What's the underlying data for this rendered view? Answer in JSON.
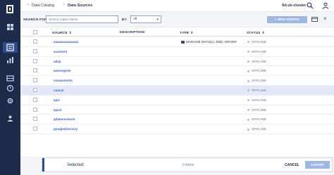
{
  "breadcrumb": {
    "items": [
      "Data Catalog",
      "Data Sources"
    ],
    "cluster": "fid-zk-cluster"
  },
  "filters": {
    "search_for_label": "SEARCH FOR",
    "search_placeholder": "Source | Spec Name",
    "by_label": "BY",
    "by_value": "All",
    "new_source_label": "+  NEW SOURCE"
  },
  "table": {
    "columns": {
      "source": "SOURCE",
      "description": "DESCRIPTION",
      "type": "TYPE",
      "status": "STATUS"
    },
    "rows": [
      {
        "source": "aaaaaaaaaaaaaa",
        "description": "",
        "type": "MARIADB (MYSQL) JDBC DRIVER",
        "status": "OFFLINE"
      },
      {
        "source": "acaclient",
        "description": "",
        "type": "",
        "status": "OFFLINE"
      },
      {
        "source": "adap",
        "description": "",
        "type": "",
        "status": "OFFLINE"
      },
      {
        "source": "awscognito",
        "description": "",
        "type": "",
        "status": "OFFLINE"
      },
      {
        "source": "components",
        "description": "",
        "type": "",
        "status": "OFFLINE"
      },
      {
        "source": "concur",
        "description": "",
        "type": "",
        "status": "OFFLINE"
      },
      {
        "source": "epic",
        "description": "",
        "type": "",
        "status": "OFFLINE"
      },
      {
        "source": "epic2",
        "description": "",
        "type": "",
        "status": "OFFLINE"
      },
      {
        "source": "gdatacontacts",
        "description": "",
        "type": "",
        "status": "OFFLINE"
      },
      {
        "source": "googledirectory",
        "description": "",
        "type": "",
        "status": "OFFLINE"
      }
    ]
  },
  "selection": {
    "label": "Selected:",
    "count": "0 items",
    "cancel_label": "CANCEL",
    "export_label": "EXPORT"
  },
  "colors": {
    "rail": "#1e2a4a",
    "accent": "#2d4d8f",
    "link": "#3b63c4",
    "selected_row": "#e3e8f8",
    "disabled_button": "#9fb6e3"
  }
}
